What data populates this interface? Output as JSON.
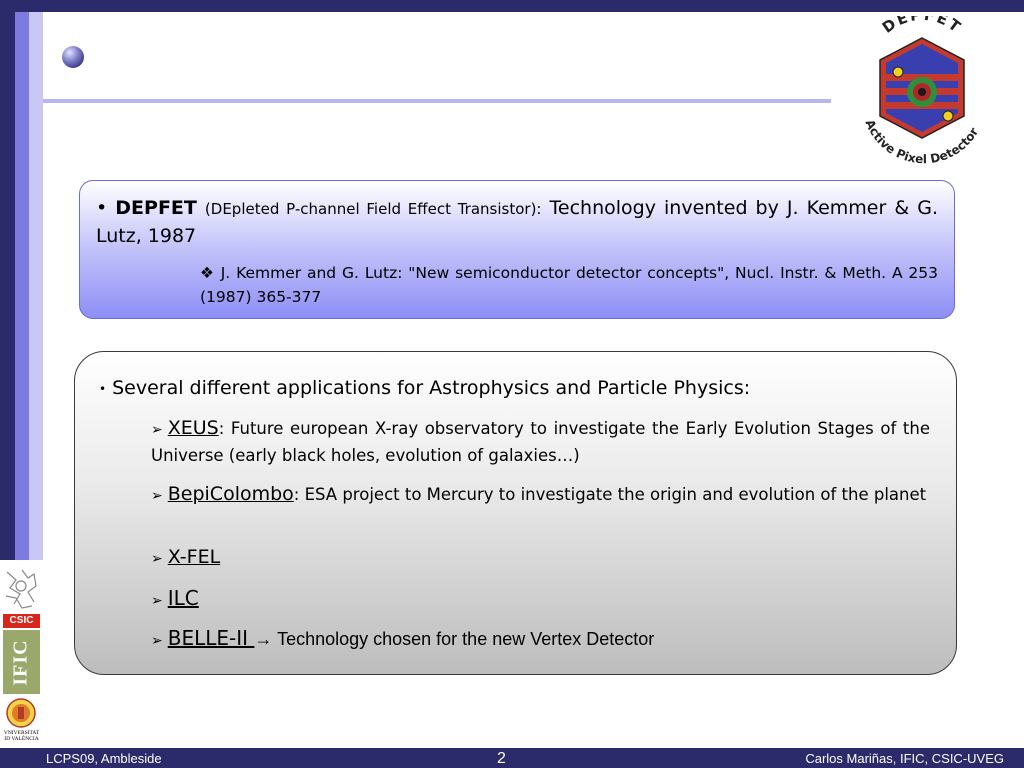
{
  "slide": {
    "logo_top_text": "DEPFET",
    "logo_ring_text": "Active Pixel Detector",
    "box1": {
      "bullet": "•",
      "term": "DEPFET",
      "definition": "(DEpleted P-channel Field Effect Transistor):",
      "statement": "Technology invented by J. Kemmer & G. Lutz, 1987",
      "reference_marker": "❖",
      "reference": "J. Kemmer and G. Lutz: \"New semiconductor detector concepts\", Nucl. Instr. & Meth. A 253 (1987) 365-377"
    },
    "box2": {
      "bullet": "•",
      "heading": "Several different applications for Astrophysics and Particle Physics:",
      "marker": "➢",
      "items": [
        {
          "name": "XEUS",
          "desc": ": Future european X-ray observatory to investigate the Early Evolution Stages of the Universe (early black holes, evolution of galaxies…)"
        },
        {
          "name": "BepiColombo",
          "desc": ": ESA project to Mercury to investigate the origin and evolution of the planet"
        },
        {
          "name": "X-FEL",
          "desc": ""
        },
        {
          "name": "ILC",
          "desc": ""
        },
        {
          "name": "BELLE-II ",
          "desc": "→ Technology chosen for the new Vertex Detector"
        }
      ]
    },
    "side_logos": {
      "csic": "CSIC",
      "ific": "IFIC",
      "uv_line1": "VNIVERSITAT",
      "uv_line2": "ID VALÈNCIA"
    }
  },
  "footer": {
    "left": "LCPS09, Ambleside",
    "page": "2",
    "right": "Carlos Mariñas, IFIC, CSIC-UVEG"
  },
  "colors": {
    "navy": "#2b2a6b",
    "accent_blue": "#7e7be0",
    "box1_gradient_end": "#8e8ef6"
  }
}
